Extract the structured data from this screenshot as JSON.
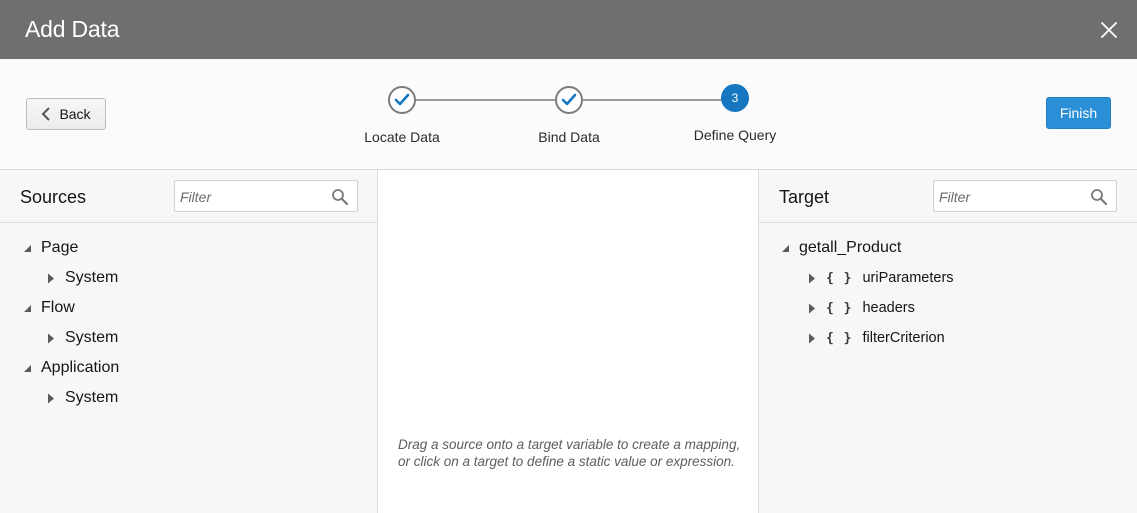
{
  "dialog": {
    "title": "Add Data",
    "close_icon": "close-icon"
  },
  "wizard": {
    "back_label": "Back",
    "finish_label": "Finish",
    "steps": [
      {
        "label": "Locate Data",
        "state": "complete"
      },
      {
        "label": "Bind Data",
        "state": "complete"
      },
      {
        "label": "Define Query",
        "state": "current",
        "number": "3"
      }
    ]
  },
  "sources": {
    "title": "Sources",
    "filter_placeholder": "Filter",
    "items": [
      {
        "label": "Page",
        "children": [
          "System"
        ]
      },
      {
        "label": "Flow",
        "children": [
          "System"
        ]
      },
      {
        "label": "Application",
        "children": [
          "System"
        ]
      }
    ]
  },
  "mapping": {
    "hint": "Drag a source onto a target variable to create a mapping, or click on a target to define a static value or expression."
  },
  "target": {
    "title": "Target",
    "filter_placeholder": "Filter",
    "root": "getall_Product",
    "children": [
      "uriParameters",
      "headers",
      "filterCriterion"
    ],
    "object_icon": "{ }"
  },
  "colors": {
    "titlebar": "#6f6f6f",
    "accent": "#1677c0",
    "finish": "#2a8fd6"
  }
}
